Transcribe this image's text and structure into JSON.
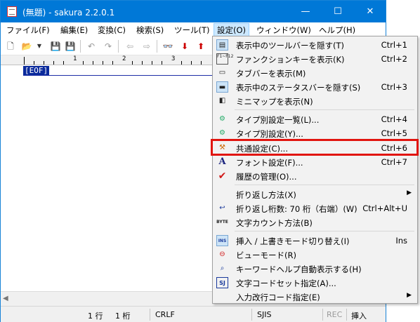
{
  "window": {
    "title": "(無題) - sakura 2.2.0.1",
    "controls": {
      "minimize": "—",
      "maximize": "☐",
      "close": "✕"
    }
  },
  "menubar": [
    "ファイル(F)",
    "編集(E)",
    "変換(C)",
    "検索(S)",
    "ツール(T)",
    "設定(O)",
    "ウィンドウ(W)",
    "ヘルプ(H)"
  ],
  "ruler": {
    "marks": [
      "1",
      "2",
      "3"
    ]
  },
  "editor": {
    "eof": "[EOF]"
  },
  "statusbar": {
    "line": "1 行",
    "col": "1 桁",
    "eol": "CRLF",
    "encoding": "SJIS",
    "rec": "REC",
    "mode": "挿入"
  },
  "settings_menu": {
    "items": [
      {
        "label": "表示中のツールバーを隠す(T)",
        "shortcut": "Ctrl+1",
        "icon": "toolbar-icon"
      },
      {
        "label": "ファンクションキーを表示(K)",
        "shortcut": "Ctrl+2",
        "icon": "function-key-icon",
        "icon_text": "F1~F12"
      },
      {
        "label": "タブバーを表示(M)",
        "shortcut": "",
        "icon": "tabbar-icon"
      },
      {
        "label": "表示中のステータスバーを隠す(S)",
        "shortcut": "Ctrl+3",
        "icon": "statusbar-icon"
      },
      {
        "label": "ミニマップを表示(N)",
        "shortcut": "",
        "icon": "minimap-icon"
      },
      {
        "label": "タイプ別設定一覧(L)...",
        "shortcut": "Ctrl+4",
        "icon": "type-list-icon"
      },
      {
        "label": "タイプ別設定(Y)...",
        "shortcut": "Ctrl+5",
        "icon": "type-settings-icon"
      },
      {
        "label": "共通設定(C)...",
        "shortcut": "Ctrl+6",
        "icon": "common-settings-icon"
      },
      {
        "label": "フォント設定(F)...",
        "shortcut": "Ctrl+7",
        "icon": "font-icon",
        "icon_text": "A"
      },
      {
        "label": "履歴の管理(O)...",
        "shortcut": "",
        "icon": "history-check-icon",
        "icon_text": "✔"
      },
      {
        "label": "折り返し方法(X)",
        "shortcut": "",
        "icon": "",
        "submenu": "▶"
      },
      {
        "label": "折り返し桁数: 70 桁（右端）(W)",
        "shortcut": "Ctrl+Alt+U",
        "icon": "wrap-icon"
      },
      {
        "label": "文字カウント方法(B)",
        "shortcut": "",
        "icon": "byte-icon",
        "icon_text": "BYTE"
      },
      {
        "label": "挿入 / 上書きモード切り替え(I)",
        "shortcut": "Ins",
        "icon": "insert-mode-icon",
        "icon_text": "INS"
      },
      {
        "label": "ビューモード(R)",
        "shortcut": "",
        "icon": "view-mode-icon"
      },
      {
        "label": "キーワードヘルプ自動表示する(H)",
        "shortcut": "",
        "icon": "keyword-help-icon"
      },
      {
        "label": "文字コードセット指定(A)...",
        "shortcut": "",
        "icon": "charset-icon",
        "icon_text": "SJ"
      },
      {
        "label": "入力改行コード指定(E)",
        "shortcut": "",
        "icon": "",
        "submenu": "▶"
      }
    ]
  },
  "colors": {
    "titlebar": "#0078d7",
    "highlight_box": "#e1150f",
    "eof_bg": "#0a2a9c"
  }
}
